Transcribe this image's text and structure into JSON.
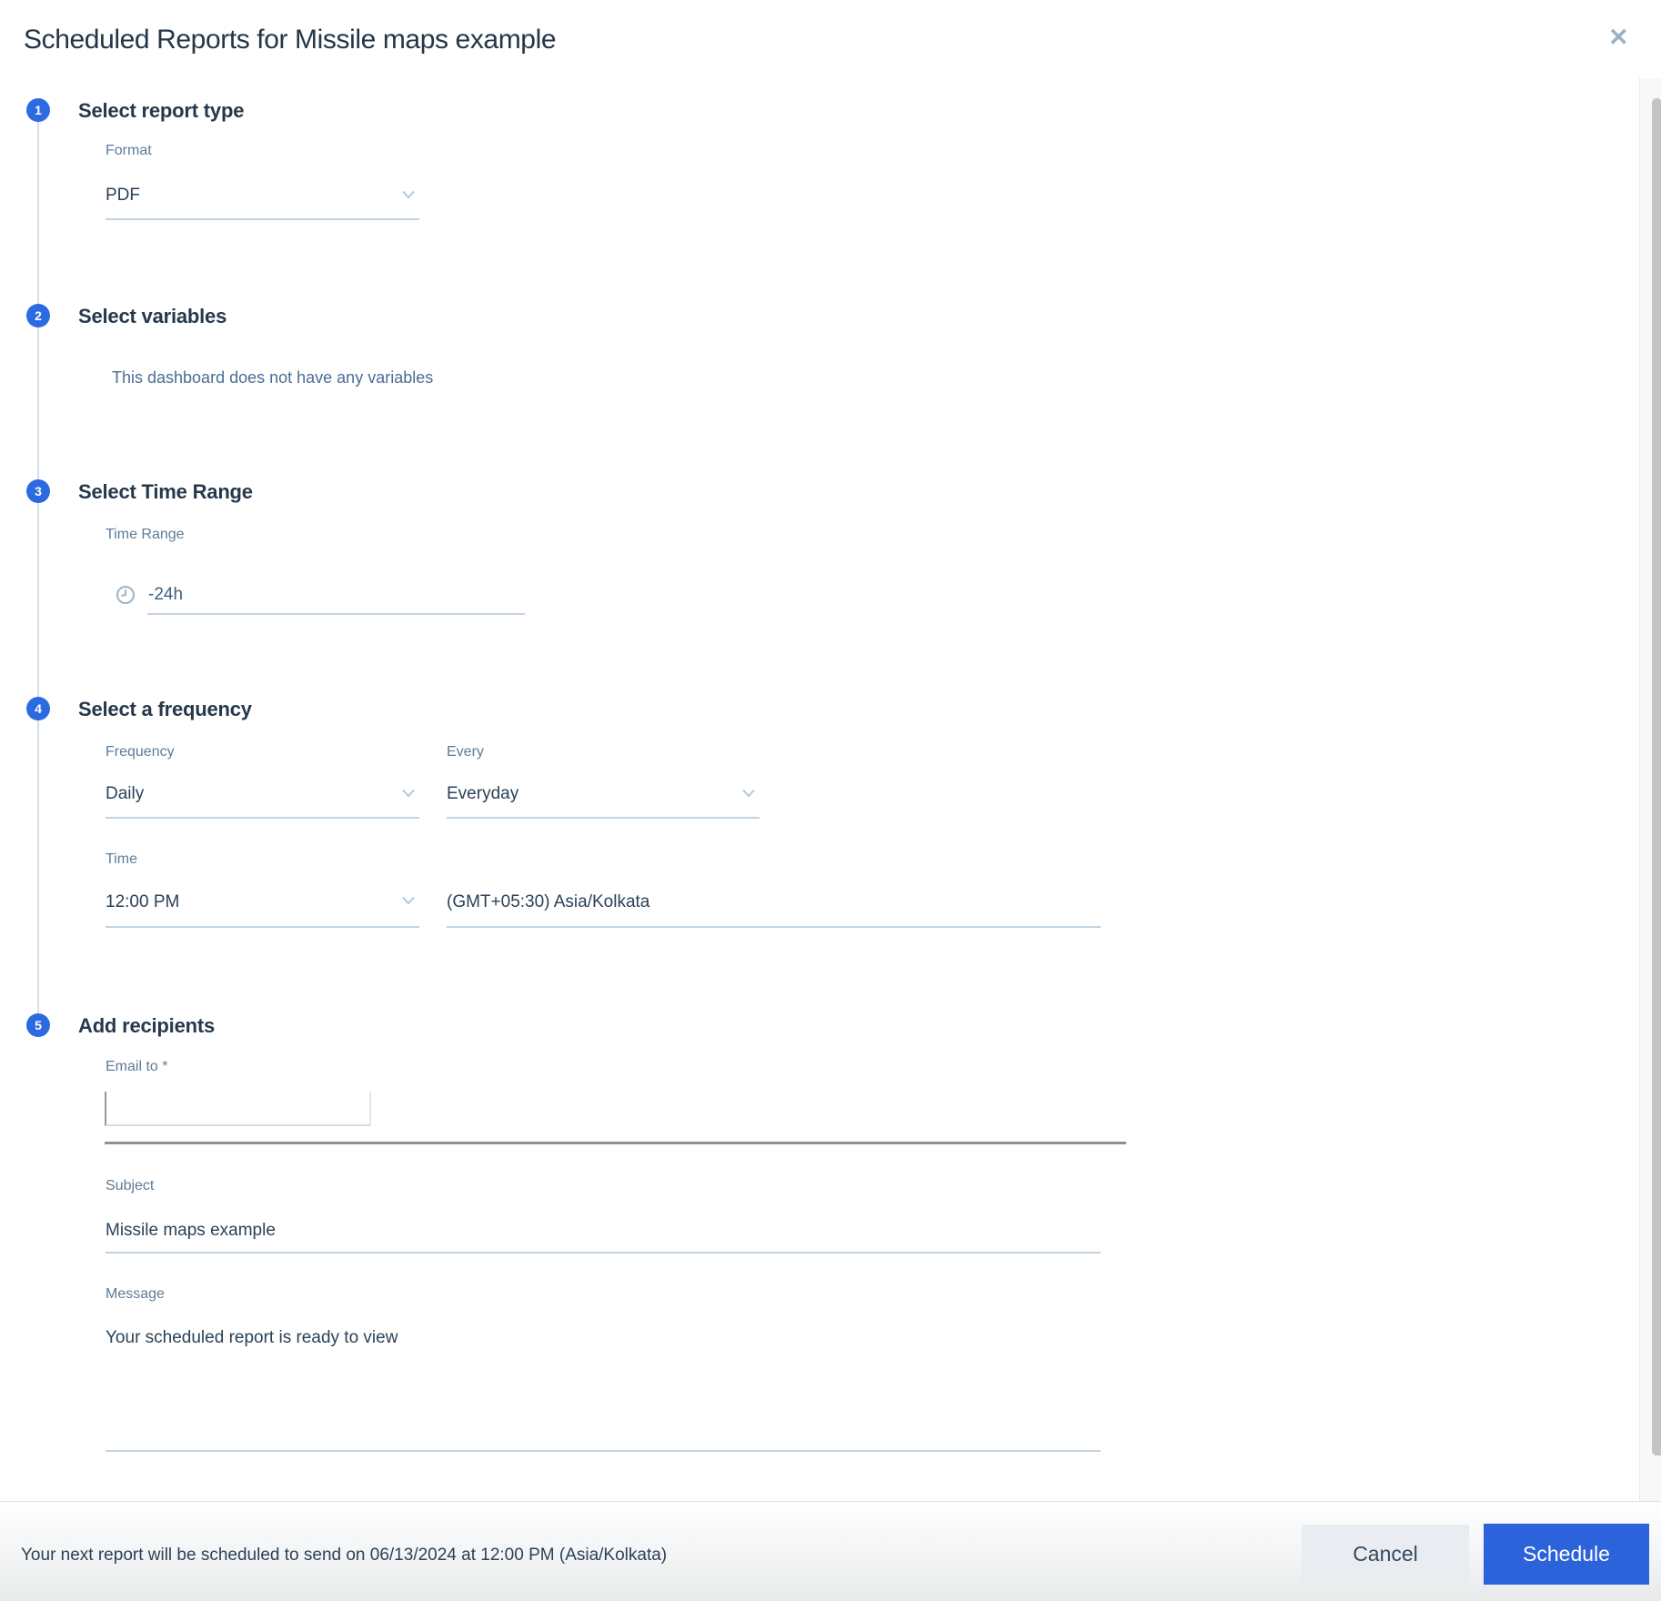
{
  "dialog": {
    "title": "Scheduled Reports for Missile maps example",
    "close_glyph": "✕"
  },
  "steps": [
    {
      "num": "1",
      "heading": "Select report type"
    },
    {
      "num": "2",
      "heading": "Select variables"
    },
    {
      "num": "3",
      "heading": "Select Time Range"
    },
    {
      "num": "4",
      "heading": "Select a frequency"
    },
    {
      "num": "5",
      "heading": "Add recipients"
    }
  ],
  "report_type": {
    "format_label": "Format",
    "format_value": "PDF"
  },
  "variables": {
    "empty_text": "This dashboard does not have any variables"
  },
  "time_range": {
    "label": "Time Range",
    "value": "-24h",
    "icon": "clock-icon"
  },
  "frequency": {
    "frequency_label": "Frequency",
    "frequency_value": "Daily",
    "every_label": "Every",
    "every_value": "Everyday",
    "time_label": "Time",
    "time_value": "12:00 PM",
    "timezone_value": "(GMT+05:30) Asia/Kolkata"
  },
  "recipients": {
    "email_label": "Email to *",
    "email_value": "",
    "subject_label": "Subject",
    "subject_value": "Missile maps example",
    "message_label": "Message",
    "message_value": "Your scheduled report is ready to view"
  },
  "footer": {
    "status_text": "Your next report will be scheduled to send on 06/13/2024 at 12:00 PM (Asia/Kolkata)",
    "cancel_label": "Cancel",
    "schedule_label": "Schedule"
  },
  "colors": {
    "accent_blue": "#2d63da",
    "step_badge_blue": "#2c6ae2",
    "heading_navy": "#26384c",
    "label_slate": "#5e7b97",
    "underline": "#c2d3e2",
    "strong_divider": "#8b9196"
  }
}
